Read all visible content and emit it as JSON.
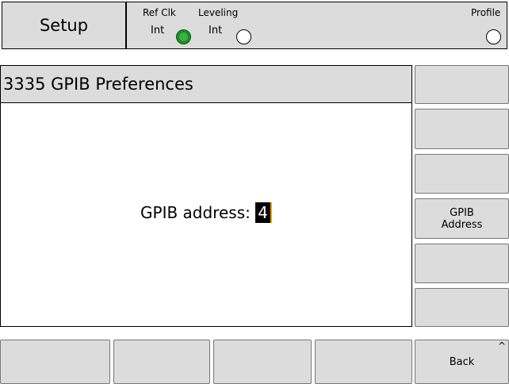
{
  "topbar": {
    "mode_label": "Setup",
    "ref_clk": {
      "label": "Ref Clk",
      "value": "Int",
      "indicator_color": "#3cb043"
    },
    "leveling": {
      "label": "Leveling",
      "value": "Int"
    },
    "profile": {
      "label": "Profile"
    }
  },
  "panel": {
    "title": "3335 GPIB Preferences",
    "address_label": "GPIB address:",
    "address_value": "4"
  },
  "softkeys_right": [
    "",
    "",
    "",
    "GPIB\nAddress",
    "",
    ""
  ],
  "softkeys_bottom": [
    "",
    "",
    "",
    "",
    "Back"
  ]
}
